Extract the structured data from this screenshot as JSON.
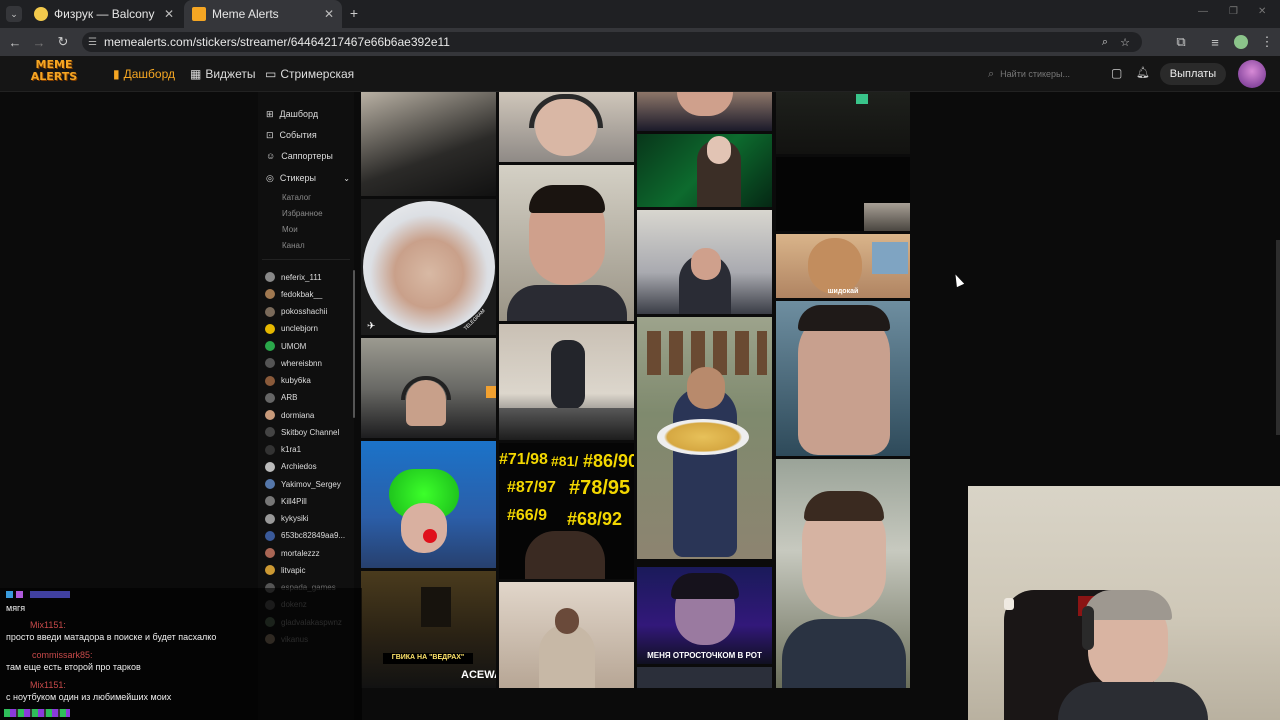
{
  "browser": {
    "tabs": [
      {
        "title": "Физрук — Balcony",
        "active": false
      },
      {
        "title": "Meme Alerts",
        "active": true
      }
    ],
    "url": "memealerts.com/stickers/streamer/64464217467e66b6ae392e11"
  },
  "header": {
    "logo_text": "MEME ALERTS",
    "nav": [
      {
        "label": "Дашборд",
        "active": true
      },
      {
        "label": "Виджеты",
        "active": false
      },
      {
        "label": "Стримерская",
        "active": false
      }
    ],
    "search_placeholder": "Найти стикеры...",
    "payout_label": "Выплаты"
  },
  "sidebar": {
    "items": [
      {
        "label": "Дашборд",
        "icon": "chart-icon"
      },
      {
        "label": "События",
        "icon": "events-icon"
      },
      {
        "label": "Саппортеры",
        "icon": "supporters-icon"
      },
      {
        "label": "Стикеры",
        "icon": "stickers-icon"
      }
    ],
    "subitems": [
      "Каталог",
      "Избранное",
      "Мои",
      "Канал"
    ],
    "users": [
      {
        "name": "neferix_111",
        "color": "#888888",
        "dim": false
      },
      {
        "name": "fedokbak__",
        "color": "#a07850",
        "dim": false
      },
      {
        "name": "pokosshachii",
        "color": "#7a6a5a",
        "dim": false
      },
      {
        "name": "unclebjorn",
        "color": "#e6b800",
        "dim": false
      },
      {
        "name": "UMOM",
        "color": "#2aa84a",
        "dim": false
      },
      {
        "name": "whereisbnn",
        "color": "#555555",
        "dim": false
      },
      {
        "name": "kuby6ka",
        "color": "#8a5a3a",
        "dim": false
      },
      {
        "name": "ARB",
        "color": "#666666",
        "dim": false
      },
      {
        "name": "dormiana",
        "color": "#c89a7a",
        "dim": false
      },
      {
        "name": "Skitboy Channel",
        "color": "#444444",
        "dim": false
      },
      {
        "name": "k1ra1",
        "color": "#333333",
        "dim": false
      },
      {
        "name": "Archiedos",
        "color": "#bbbbbb",
        "dim": false
      },
      {
        "name": "Yakimov_Sergey",
        "color": "#5577aa",
        "dim": false
      },
      {
        "name": "Kill4Pill",
        "color": "#777777",
        "dim": false
      },
      {
        "name": "kykysiki",
        "color": "#999999",
        "dim": false
      },
      {
        "name": "653bc82849aa9...",
        "color": "#3a5a9a",
        "dim": false
      },
      {
        "name": "mortalezzz",
        "color": "#aa6655",
        "dim": false
      },
      {
        "name": "litvapic",
        "color": "#cc9933",
        "dim": false
      },
      {
        "name": "espada_games",
        "color": "#555555",
        "dim": true
      },
      {
        "name": "dokenz",
        "color": "#444444",
        "dim": true
      },
      {
        "name": "gladvalakaspwnz",
        "color": "#445544",
        "dim": true
      },
      {
        "name": "vikanus",
        "color": "#776655",
        "dim": true
      }
    ]
  },
  "stickers": {
    "captions": {
      "sho": "шидокай",
      "numbers": [
        "#71/98",
        "#81/",
        "#86/90",
        "#87/97",
        "#78/95",
        "#66/9",
        "#68/92"
      ],
      "rot": "МЕНЯ ОТРОСТОЧКОМ В РОТ",
      "vedrah": "ГВИКА НА \"ВЕДРАХ\"",
      "acewa": "ACEWA",
      "telegram": "TELEGRAM"
    }
  },
  "chat": {
    "messages": [
      {
        "user": "",
        "text": "мягя"
      },
      {
        "user": "Mix1151:",
        "text": "просто введи матадора в поиске и будет пасхалко"
      },
      {
        "user": "commissark85:",
        "text": "там еще есть второй про тарков"
      },
      {
        "user": "Mix1151:",
        "text": "с ноутбуком один из любимейших моих"
      }
    ]
  }
}
